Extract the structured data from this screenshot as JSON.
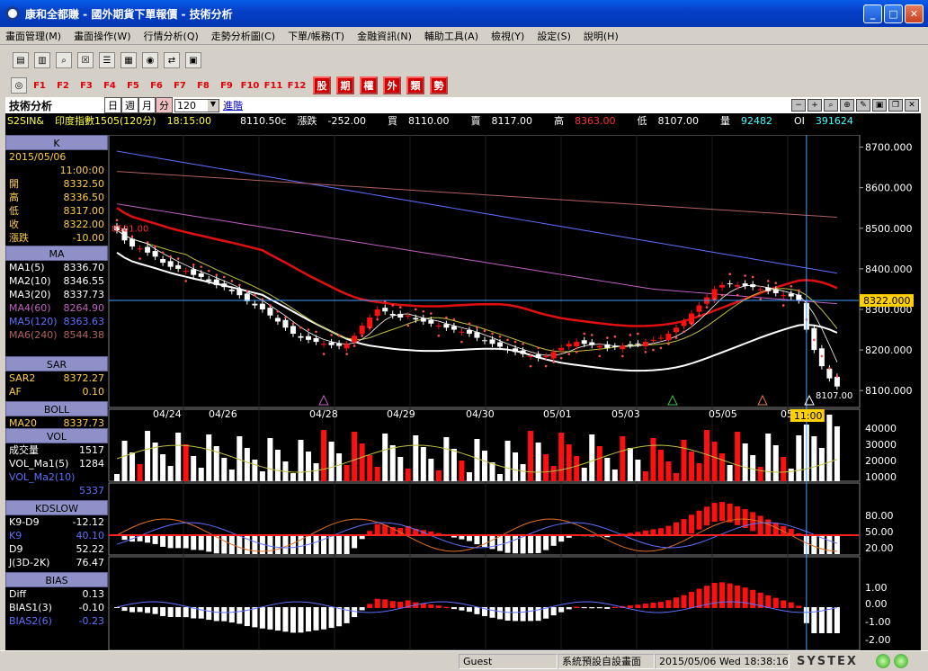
{
  "window": {
    "title": "康和全都賺 - 國外期貨下單報價 - 技術分析",
    "min": "_",
    "max": "□",
    "close": "✕"
  },
  "menu": [
    "畫面管理(M)",
    "畫面操作(W)",
    "行情分析(Q)",
    "走勢分析圖(C)",
    "下單/帳務(T)",
    "金融資訊(N)",
    "輔助工具(A)",
    "檢視(Y)",
    "設定(S)",
    "說明(H)"
  ],
  "toolbar": {
    "icons": [
      "window-icon",
      "monitor-icon",
      "zoom-icon",
      "close-box-icon",
      "list-icon",
      "layout-icon",
      "globe-icon",
      "link-icon",
      "chart-box-icon"
    ]
  },
  "fkeys": [
    "F1",
    "F2",
    "F3",
    "F4",
    "F5",
    "F6",
    "F7",
    "F8",
    "F9",
    "F10",
    "F11",
    "F12"
  ],
  "rbtns": [
    "股",
    "期",
    "權",
    "外",
    "類",
    "勢"
  ],
  "panel": {
    "title": "技術分析",
    "periods": [
      "日",
      "週",
      "月",
      "分"
    ],
    "active": "分",
    "count": "120",
    "advance": "進階"
  },
  "quote": {
    "symbol": "S2SIN&",
    "name": "印度指數1505(120分)",
    "time": "18:15:00",
    "last": "8110.50c",
    "chg_label": "漲跌",
    "chg": "-252.00",
    "bid_label": "買",
    "bid": "8110.00",
    "ask_label": "賣",
    "ask": "8117.00",
    "high_label": "高",
    "high": "8363.00",
    "low_label": "低",
    "low": "8107.00",
    "vol_label": "量",
    "vol": "92482",
    "oi_label": "OI",
    "oi": "391624"
  },
  "k_panel": {
    "header": "K",
    "date": "2015/05/06",
    "time": "11:00:00",
    "rows": [
      [
        "開",
        "8332.50"
      ],
      [
        "高",
        "8336.50"
      ],
      [
        "低",
        "8317.00"
      ],
      [
        "收",
        "8322.00"
      ],
      [
        "漲跌",
        "-10.00"
      ]
    ]
  },
  "ma_panel": {
    "header": "MA",
    "rows": [
      [
        "MA1(5)",
        "8336.70"
      ],
      [
        "MA2(10)",
        "8346.55"
      ],
      [
        "MA3(20)",
        "8337.73"
      ],
      [
        "MA4(60)",
        "8264.90"
      ],
      [
        "MA5(120)",
        "8363.63"
      ],
      [
        "MA6(240)",
        "8544.38"
      ]
    ]
  },
  "sar_panel": {
    "header": "SAR",
    "rows": [
      [
        "SAR2",
        "8372.27"
      ],
      [
        "AF",
        "0.10"
      ]
    ]
  },
  "boll_panel": {
    "header": "BOLL",
    "rows": [
      [
        "MA20",
        "8337.73"
      ]
    ]
  },
  "vol_panel": {
    "header": "VOL",
    "rows": [
      [
        "成交量",
        "1517"
      ],
      [
        "VOL_Ma1(5)",
        "1284"
      ],
      [
        "VOL_Ma2(10)",
        ""
      ],
      [
        "",
        "5337"
      ]
    ]
  },
  "kd_panel": {
    "header": "KDSLOW",
    "rows": [
      [
        "K9-D9",
        "-12.12"
      ],
      [
        "K9",
        "40.10"
      ],
      [
        "D9",
        "52.22"
      ],
      [
        "J(3D-2K)",
        "76.47"
      ]
    ]
  },
  "bias_panel": {
    "header": "BIAS",
    "rows": [
      [
        "Diff",
        "0.13"
      ],
      [
        "BIAS1(3)",
        "-0.10"
      ],
      [
        "BIAS2(6)",
        "-0.23"
      ]
    ]
  },
  "colors": {
    "up": "#ff1010",
    "down": "#ffffff",
    "sar": "#ff5050",
    "boll": "#e01010",
    "ma4": "#c060c0",
    "ma5": "#6070ff",
    "ma6": "#b06060"
  },
  "chart_data": {
    "type": "candlestick",
    "price_axis": {
      "ticks": [
        "8700.000",
        "8600.000",
        "8500.000",
        "8400.000",
        "8300.000",
        "8200.000",
        "8100.000"
      ],
      "min": 8065,
      "max": 8730
    },
    "date_labels": [
      "04/24",
      "04/26",
      "04/28",
      "04/29",
      "04/30",
      "05/01",
      "05/03",
      "05/05",
      "05/"
    ],
    "cursor_label": "11:00",
    "current_price": "8322.000",
    "high_mark": "8501.00",
    "low_mark": "8107.00",
    "vol_axis": [
      "40000",
      "30000",
      "20000",
      "10000"
    ],
    "kd_axis": [
      "80.00",
      "50.00",
      "20.00"
    ],
    "bias_axis": [
      "1.00",
      "0.00",
      "-1.00",
      "-2.00"
    ],
    "closes": [
      8495,
      8470,
      8455,
      8450,
      8440,
      8430,
      8415,
      8405,
      8400,
      8395,
      8385,
      8380,
      8370,
      8360,
      8355,
      8345,
      8335,
      8320,
      8310,
      8300,
      8285,
      8270,
      8255,
      8240,
      8230,
      8225,
      8220,
      8215,
      8212,
      8210,
      8215,
      8235,
      8260,
      8280,
      8300,
      8295,
      8285,
      8280,
      8285,
      8275,
      8270,
      8265,
      8260,
      8255,
      8250,
      8245,
      8240,
      8230,
      8222,
      8215,
      8208,
      8200,
      8195,
      8190,
      8185,
      8180,
      8185,
      8195,
      8205,
      8215,
      8220,
      8215,
      8212,
      8210,
      8205,
      8208,
      8210,
      8212,
      8215,
      8220,
      8225,
      8230,
      8240,
      8255,
      8270,
      8290,
      8310,
      8330,
      8350,
      8360,
      8362,
      8360,
      8358,
      8355,
      8350,
      8345,
      8340,
      8335,
      8332,
      8322,
      8250,
      8200,
      8160,
      8130,
      8110
    ]
  },
  "status": {
    "user": "Guest",
    "layout": "系統預設自設畫面",
    "datetime": "2015/05/06 Wed 18:38:16",
    "brand": "SYSTEX"
  }
}
